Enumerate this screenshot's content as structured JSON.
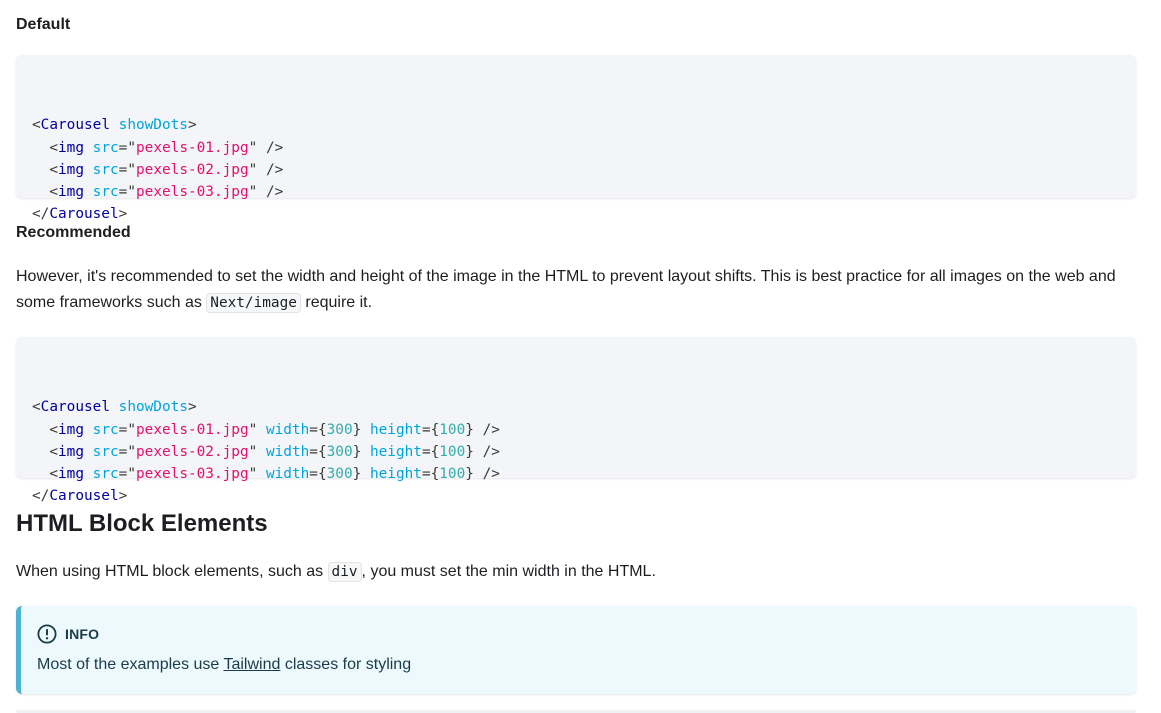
{
  "sections": {
    "default_heading": "Default",
    "recommended_heading": "Recommended",
    "recommended_text_before": "However, it's recommended to set the width and height of the image in the HTML to prevent layout shifts. This is best practice for all images on the web and some frameworks such as ",
    "recommended_code": "Next/image",
    "recommended_text_after": " require it.",
    "html_block_heading": "HTML Block Elements",
    "html_block_text_before": "When using HTML block elements, such as ",
    "html_block_code": "div",
    "html_block_text_after": ", you must set the min width in the HTML."
  },
  "code_default": {
    "lines": [
      {
        "tokens": [
          [
            "p",
            "<"
          ],
          [
            "t",
            "Carousel"
          ],
          [
            "p",
            " "
          ],
          [
            "a",
            "showDots"
          ],
          [
            "p",
            ">"
          ]
        ]
      },
      {
        "tokens": [
          [
            "p",
            "  <"
          ],
          [
            "t",
            "img"
          ],
          [
            "p",
            " "
          ],
          [
            "a",
            "src"
          ],
          [
            "p",
            "=\""
          ],
          [
            "s",
            "pexels-01.jpg"
          ],
          [
            "p",
            "\" />"
          ]
        ]
      },
      {
        "tokens": [
          [
            "p",
            "  <"
          ],
          [
            "t",
            "img"
          ],
          [
            "p",
            " "
          ],
          [
            "a",
            "src"
          ],
          [
            "p",
            "=\""
          ],
          [
            "s",
            "pexels-02.jpg"
          ],
          [
            "p",
            "\" />"
          ]
        ]
      },
      {
        "tokens": [
          [
            "p",
            "  <"
          ],
          [
            "t",
            "img"
          ],
          [
            "p",
            " "
          ],
          [
            "a",
            "src"
          ],
          [
            "p",
            "=\""
          ],
          [
            "s",
            "pexels-03.jpg"
          ],
          [
            "p",
            "\" />"
          ]
        ]
      },
      {
        "tokens": [
          [
            "p",
            "</"
          ],
          [
            "t",
            "Carousel"
          ],
          [
            "p",
            ">"
          ]
        ]
      }
    ]
  },
  "code_recommended": {
    "lines": [
      {
        "tokens": [
          [
            "p",
            "<"
          ],
          [
            "t",
            "Carousel"
          ],
          [
            "p",
            " "
          ],
          [
            "a",
            "showDots"
          ],
          [
            "p",
            ">"
          ]
        ]
      },
      {
        "tokens": [
          [
            "p",
            "  <"
          ],
          [
            "t",
            "img"
          ],
          [
            "p",
            " "
          ],
          [
            "a",
            "src"
          ],
          [
            "p",
            "=\""
          ],
          [
            "s",
            "pexels-01.jpg"
          ],
          [
            "p",
            "\" "
          ],
          [
            "a",
            "width"
          ],
          [
            "p",
            "={"
          ],
          [
            "n",
            "300"
          ],
          [
            "p",
            "} "
          ],
          [
            "a",
            "height"
          ],
          [
            "p",
            "={"
          ],
          [
            "n",
            "100"
          ],
          [
            "p",
            "} />"
          ]
        ]
      },
      {
        "tokens": [
          [
            "p",
            "  <"
          ],
          [
            "t",
            "img"
          ],
          [
            "p",
            " "
          ],
          [
            "a",
            "src"
          ],
          [
            "p",
            "=\""
          ],
          [
            "s",
            "pexels-02.jpg"
          ],
          [
            "p",
            "\" "
          ],
          [
            "a",
            "width"
          ],
          [
            "p",
            "={"
          ],
          [
            "n",
            "300"
          ],
          [
            "p",
            "} "
          ],
          [
            "a",
            "height"
          ],
          [
            "p",
            "={"
          ],
          [
            "n",
            "100"
          ],
          [
            "p",
            "} />"
          ]
        ]
      },
      {
        "tokens": [
          [
            "p",
            "  <"
          ],
          [
            "t",
            "img"
          ],
          [
            "p",
            " "
          ],
          [
            "a",
            "src"
          ],
          [
            "p",
            "=\""
          ],
          [
            "s",
            "pexels-03.jpg"
          ],
          [
            "p",
            "\" "
          ],
          [
            "a",
            "width"
          ],
          [
            "p",
            "={"
          ],
          [
            "n",
            "300"
          ],
          [
            "p",
            "} "
          ],
          [
            "a",
            "height"
          ],
          [
            "p",
            "={"
          ],
          [
            "n",
            "100"
          ],
          [
            "p",
            "} />"
          ]
        ]
      },
      {
        "tokens": [
          [
            "p",
            "</"
          ],
          [
            "t",
            "Carousel"
          ],
          [
            "p",
            ">"
          ]
        ]
      }
    ]
  },
  "admonition": {
    "icon": "info-circle-icon",
    "label": "INFO",
    "text_before": "Most of the examples use ",
    "link_text": "Tailwind",
    "text_after": " classes for styling",
    "accent_color": "#4cb3d4",
    "background_color": "#eef9fd"
  }
}
